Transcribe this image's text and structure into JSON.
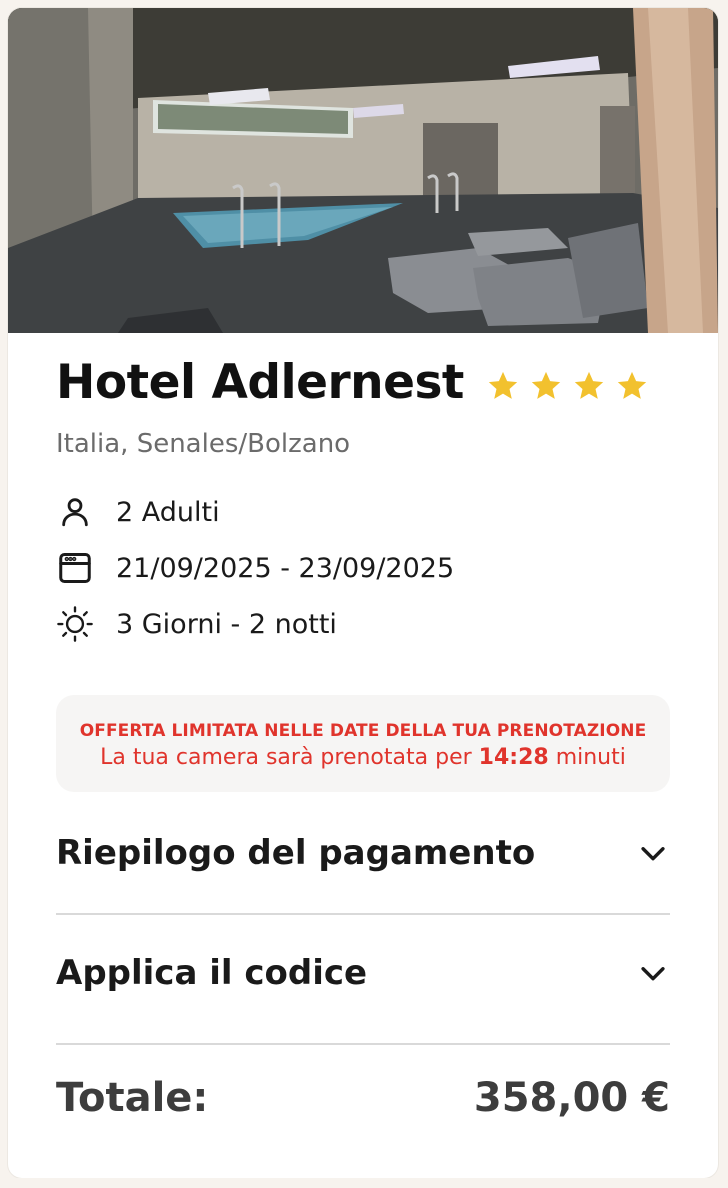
{
  "hotel": {
    "name": "Hotel Adlernest",
    "star_count": 4,
    "location": "Italia, Senales/Bolzano",
    "image_icon": "indoor-pool-photo"
  },
  "details": {
    "guests": "2 Adulti",
    "dates": "21/09/2025 - 23/09/2025",
    "duration": "3 Giorni - 2 notti"
  },
  "offer": {
    "headline": "OFFERTA LIMITATA NELLE DATE DELLA TUA PRENOTAZIONE",
    "text_before": "La tua camera sarà prenotata per",
    "timer": "14:28",
    "text_after": "minuti"
  },
  "sections": {
    "payment_summary": "Riepilogo del pagamento",
    "apply_code": "Applica il codice"
  },
  "total": {
    "label": "Totale:",
    "amount": "358,00 €"
  },
  "colors": {
    "star": "#f2c12e",
    "offer_red": "#e0342c",
    "offer_bg": "#f6f5f4"
  }
}
